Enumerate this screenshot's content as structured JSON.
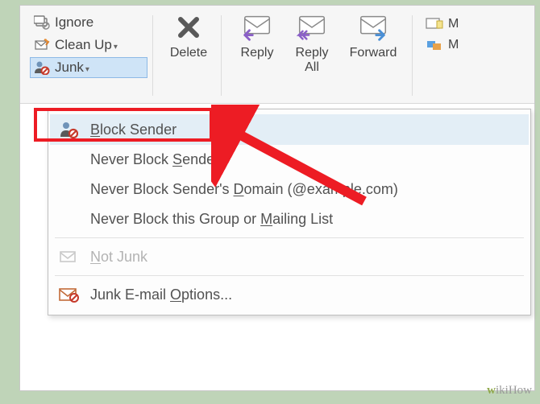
{
  "ribbon": {
    "ignore_label": "Ignore",
    "cleanup_label": "Clean Up",
    "junk_label": "Junk",
    "delete_label": "Delete",
    "reply_label": "Reply",
    "reply_all_line1": "Reply",
    "reply_all_line2": "All",
    "forward_label": "Forward",
    "right_m1": "M",
    "right_m2": "M"
  },
  "menu": {
    "block_sender": "Block Sender",
    "never_block_sender": "Never Block Sender",
    "never_block_domain": "Never Block Sender's Domain (@example.com)",
    "never_block_group": "Never Block this Group or Mailing List",
    "not_junk": "Not Junk",
    "options": "Junk E-mail Options..."
  },
  "watermark": "wikiHow"
}
